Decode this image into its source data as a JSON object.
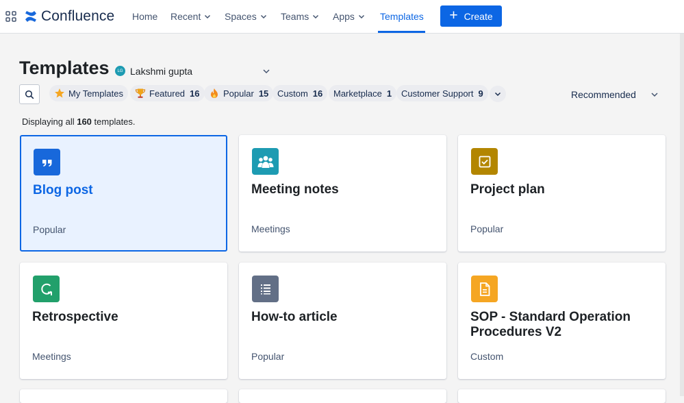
{
  "nav": {
    "product": "Confluence",
    "items": [
      {
        "label": "Home"
      },
      {
        "label": "Recent"
      },
      {
        "label": "Spaces"
      },
      {
        "label": "Teams"
      },
      {
        "label": "Apps"
      },
      {
        "label": "Templates"
      }
    ],
    "create_label": "Create",
    "accent_color": "#0c66e4"
  },
  "header": {
    "title": "Templates",
    "user_initials": "LG",
    "user_name": "Lakshmi gupta"
  },
  "filters": {
    "chips": [
      {
        "label": "My Templates",
        "icon": "star-icon"
      },
      {
        "label": "Featured",
        "count": "16",
        "icon": "trophy-icon"
      },
      {
        "label": "Popular",
        "count": "15",
        "icon": "fire-icon"
      },
      {
        "label": "Custom",
        "count": "16"
      },
      {
        "label": "Marketplace",
        "count": "1"
      },
      {
        "label": "Customer Support",
        "count": "9"
      }
    ],
    "sort_label": "Recommended"
  },
  "summary": {
    "prefix": "Displaying all",
    "count": "160",
    "suffix": "templates."
  },
  "templates": [
    {
      "title": "Blog post",
      "category": "Popular",
      "icon": "quote-icon",
      "color": "#1868db"
    },
    {
      "title": "Meeting notes",
      "category": "Meetings",
      "icon": "people-icon",
      "color": "#1d9bb2"
    },
    {
      "title": "Project plan",
      "category": "Popular",
      "icon": "checkbox-icon",
      "color": "#b38600"
    },
    {
      "title": "Retrospective",
      "category": "Meetings",
      "icon": "cycle-icon",
      "color": "#22a06b"
    },
    {
      "title": "How-to article",
      "category": "Popular",
      "icon": "list-icon",
      "color": "#626f86"
    },
    {
      "title": "SOP - Standard Operation Procedures V2",
      "category": "Custom",
      "icon": "document-icon",
      "color": "#f5a623"
    }
  ]
}
